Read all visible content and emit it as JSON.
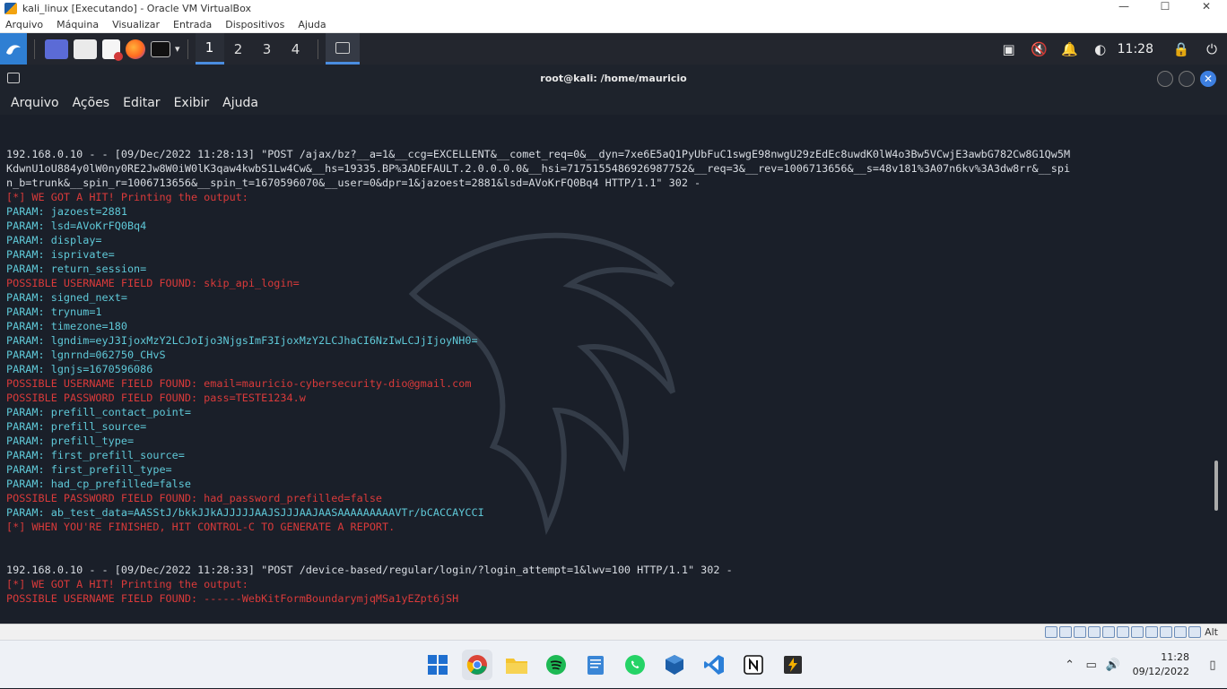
{
  "vbox": {
    "title": "kali_linux [Executando] - Oracle VM VirtualBox",
    "controls": {
      "minimize": "—",
      "maximize": "☐",
      "close": "✕"
    },
    "menu": [
      "Arquivo",
      "Máquina",
      "Visualizar",
      "Entrada",
      "Dispositivos",
      "Ajuda"
    ],
    "status_host_key": "Alt"
  },
  "kali_panel": {
    "workspaces": [
      "1",
      "2",
      "3",
      "4"
    ],
    "active_workspace": "1",
    "clock": "11:28"
  },
  "terminal": {
    "title": "root@kali: /home/mauricio",
    "menu": [
      "Arquivo",
      "Ações",
      "Editar",
      "Exibir",
      "Ajuda"
    ],
    "lines": [
      {
        "kind": "normal",
        "text": "192.168.0.10 - - [09/Dec/2022 11:28:13] \"POST /ajax/bz?__a=1&__ccg=EXCELLENT&__comet_req=0&__dyn=7xe6E5aQ1PyUbFuC1swgE98nwgU29zEdEc8uwdK0lW4o3Bw5VCwjE3awbG782Cw8G1Qw5M"
      },
      {
        "kind": "normal",
        "text": "KdwnU1oU884y0lW0ny0RE2Jw8W0iW0lK3qaw4kwbS1Lw4Cw&__hs=19335.BP%3ADEFAULT.2.0.0.0.0&__hsi=7175155486926987752&__req=3&__rev=1006713656&__s=48v181%3A07n6kv%3A3dw8rr&__spi"
      },
      {
        "kind": "normal",
        "text": "n_b=trunk&__spin_r=1006713656&__spin_t=1670596070&__user=0&dpr=1&jazoest=2881&lsd=AVoKrFQ0Bq4 HTTP/1.1\" 302 -"
      },
      {
        "kind": "red",
        "text": "[*] WE GOT A HIT! Printing the output:"
      },
      {
        "kind": "param",
        "text": "PARAM: jazoest=2881"
      },
      {
        "kind": "param",
        "text": "PARAM: lsd=AVoKrFQ0Bq4"
      },
      {
        "kind": "param",
        "text": "PARAM: display="
      },
      {
        "kind": "param",
        "text": "PARAM: isprivate="
      },
      {
        "kind": "param",
        "text": "PARAM: return_session="
      },
      {
        "kind": "red",
        "text": "POSSIBLE USERNAME FIELD FOUND: skip_api_login="
      },
      {
        "kind": "param",
        "text": "PARAM: signed_next="
      },
      {
        "kind": "param",
        "text": "PARAM: trynum=1"
      },
      {
        "kind": "param",
        "text": "PARAM: timezone=180"
      },
      {
        "kind": "param",
        "text": "PARAM: lgndim=eyJ3IjoxMzY2LCJoIjo3NjgsImF3IjoxMzY2LCJhaCI6NzIwLCJjIjoyNH0="
      },
      {
        "kind": "param",
        "text": "PARAM: lgnrnd=062750_CHvS"
      },
      {
        "kind": "param",
        "text": "PARAM: lgnjs=1670596086"
      },
      {
        "kind": "red",
        "text": "POSSIBLE USERNAME FIELD FOUND: email=mauricio-cybersecurity-dio@gmail.com"
      },
      {
        "kind": "red",
        "text": "POSSIBLE PASSWORD FIELD FOUND: pass=TESTE1234.w"
      },
      {
        "kind": "param",
        "text": "PARAM: prefill_contact_point="
      },
      {
        "kind": "param",
        "text": "PARAM: prefill_source="
      },
      {
        "kind": "param",
        "text": "PARAM: prefill_type="
      },
      {
        "kind": "param",
        "text": "PARAM: first_prefill_source="
      },
      {
        "kind": "param",
        "text": "PARAM: first_prefill_type="
      },
      {
        "kind": "param",
        "text": "PARAM: had_cp_prefilled=false"
      },
      {
        "kind": "red",
        "text": "POSSIBLE PASSWORD FIELD FOUND: had_password_prefilled=false"
      },
      {
        "kind": "param",
        "text": "PARAM: ab_test_data=AASStJ/bkkJJkAJJJJJAAJSJJJAAJAASAAAAAAAAAVTr/bCACCAYCCI"
      },
      {
        "kind": "red",
        "text": "[*] WHEN YOU'RE FINISHED, HIT CONTROL-C TO GENERATE A REPORT."
      },
      {
        "kind": "blank",
        "text": ""
      },
      {
        "kind": "blank",
        "text": ""
      },
      {
        "kind": "normal",
        "text": "192.168.0.10 - - [09/Dec/2022 11:28:33] \"POST /device-based/regular/login/?login_attempt=1&lwv=100 HTTP/1.1\" 302 -"
      },
      {
        "kind": "red",
        "text": "[*] WE GOT A HIT! Printing the output:"
      },
      {
        "kind": "red",
        "text": "POSSIBLE USERNAME FIELD FOUND: ------WebKitFormBoundarymjqMSa1yEZpt6jSH"
      }
    ]
  },
  "windows_taskbar": {
    "time": "11:28",
    "date": "09/12/2022",
    "colors": {
      "chrome": "#db4437",
      "spotify": "#1db954",
      "whatsapp": "#25d366",
      "vscode": "#2b7fd8",
      "folder": "#f4c430"
    }
  },
  "colors": {
    "terminal_bg": "#1a1f29",
    "param_text": "#5fc9d8",
    "alert_text": "#d93a3a",
    "accent": "#4a8de0"
  }
}
